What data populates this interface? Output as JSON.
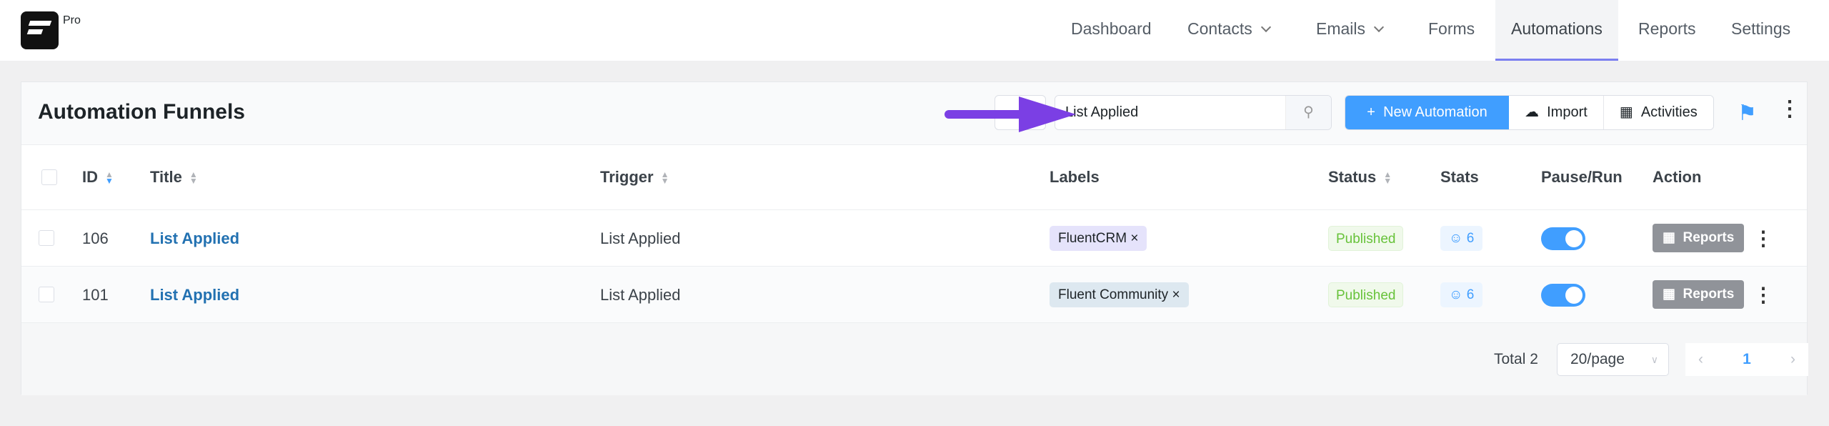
{
  "brand": {
    "badge": "Pro"
  },
  "nav": {
    "items": [
      {
        "label": "Dashboard"
      },
      {
        "label": "Contacts"
      },
      {
        "label": "Emails"
      },
      {
        "label": "Forms"
      },
      {
        "label": "Automations"
      },
      {
        "label": "Reports"
      },
      {
        "label": "Settings"
      }
    ],
    "active": "Automations"
  },
  "page": {
    "title": "Automation Funnels"
  },
  "search": {
    "value": "List Applied"
  },
  "toolbar": {
    "new_label": "New Automation",
    "import_label": "Import",
    "activities_label": "Activities"
  },
  "table": {
    "columns": {
      "id": "ID",
      "title": "Title",
      "trigger": "Trigger",
      "labels": "Labels",
      "status": "Status",
      "stats": "Stats",
      "pause_run": "Pause/Run",
      "action": "Action"
    },
    "rows": [
      {
        "id": "106",
        "title": "List Applied",
        "trigger": "List Applied",
        "label": "FluentCRM",
        "label_color": "#e5e3fb",
        "status": "Published",
        "stats": "6",
        "running": true,
        "action": "Reports"
      },
      {
        "id": "101",
        "title": "List Applied",
        "trigger": "List Applied",
        "label": "Fluent Community",
        "label_color": "#dde8f0",
        "status": "Published",
        "stats": "6",
        "running": true,
        "action": "Reports"
      }
    ]
  },
  "pagination": {
    "total": "Total 2",
    "page_size": "20/page",
    "current": "1"
  },
  "colors": {
    "primary": "#409eff",
    "arrow": "#7b3fe4",
    "published": "#67c23a"
  }
}
